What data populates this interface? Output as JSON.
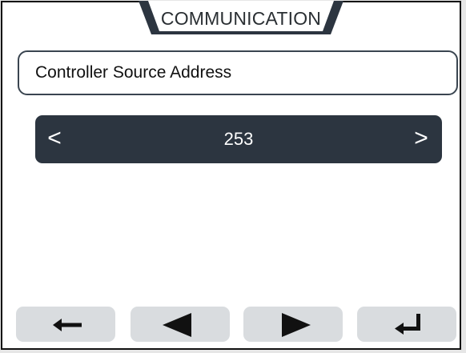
{
  "header": {
    "tab_title": "COMMUNICATION"
  },
  "parameter": {
    "label": "Controller Source Address"
  },
  "selector": {
    "value": "253",
    "prev_label": "<",
    "next_label": ">"
  },
  "softkeys": [
    {
      "icon": "back-arrow-icon"
    },
    {
      "icon": "triangle-left-icon"
    },
    {
      "icon": "triangle-right-icon"
    },
    {
      "icon": "enter-icon"
    }
  ],
  "colors": {
    "bar": "#2c3540",
    "softkey": "#d9dcdf",
    "tab": "#2c3540"
  }
}
